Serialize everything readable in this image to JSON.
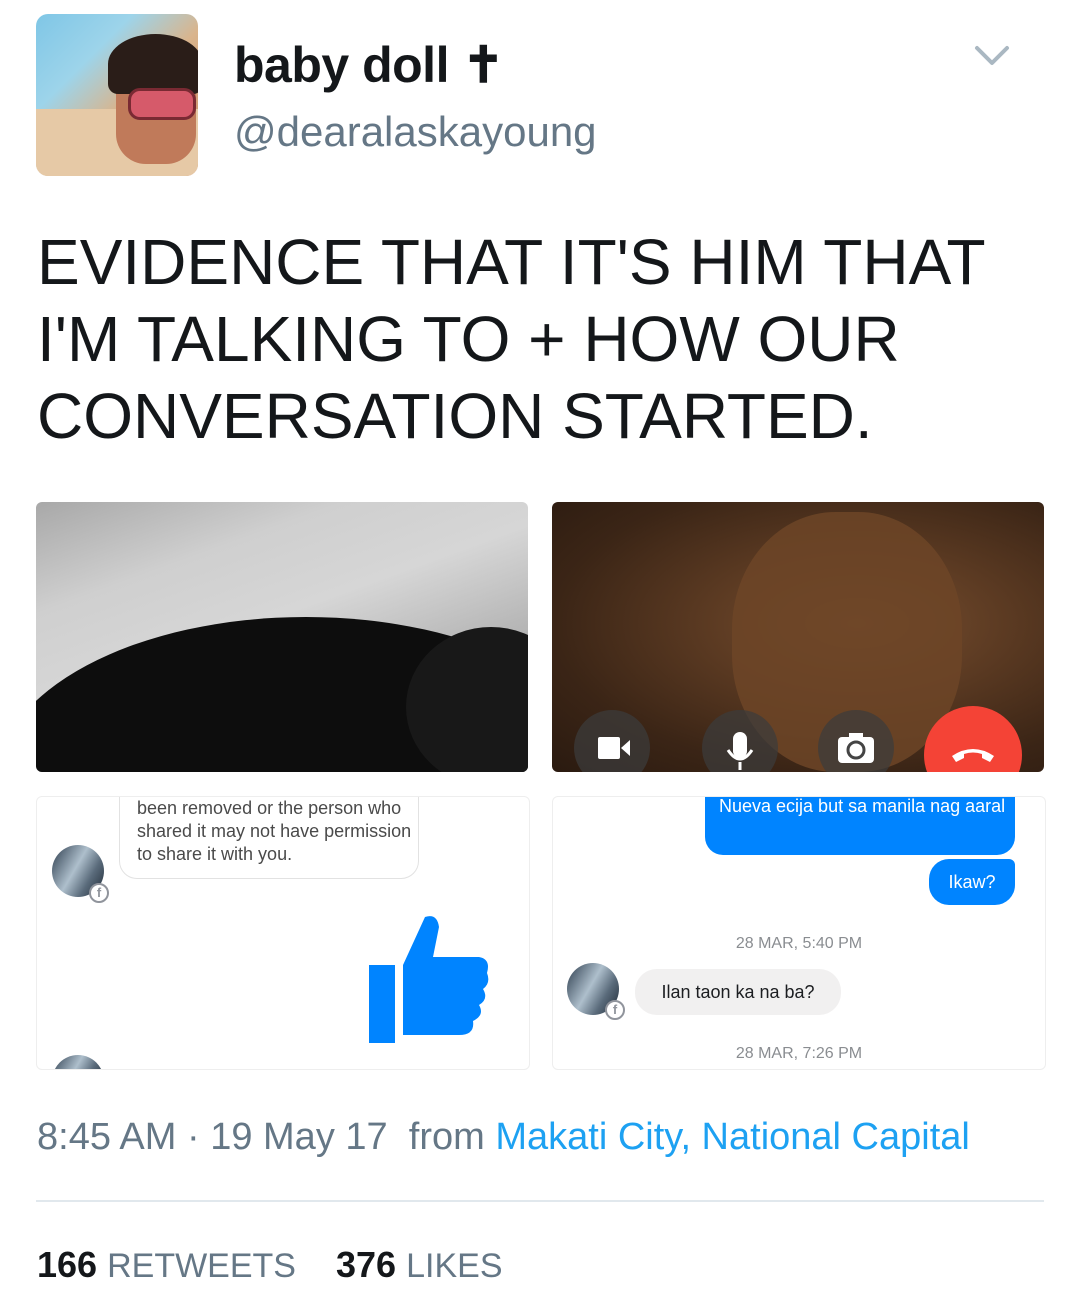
{
  "user": {
    "display_name": "baby doll ✝",
    "handle": "@dearalaskayoung"
  },
  "tweet": {
    "text": "EVIDENCE THAT IT'S HIM THAT I'M TALKING TO + HOW OUR CONVERSATION STARTED."
  },
  "screenshot3": {
    "message": "been removed or the person who shared it may not have permission to share it with you."
  },
  "screenshot4": {
    "sent_1": "Nueva ecija but sa manila nag aaral",
    "sent_2": "Ikaw?",
    "timestamp_1": "28 MAR, 5:40 PM",
    "received": "Ilan taon ka na ba?",
    "timestamp_2": "28 MAR, 7:26 PM"
  },
  "meta": {
    "time": "8:45 AM",
    "separator": " · ",
    "date": "19 May 17",
    "from_label": "from",
    "location": "Makati City, National Capital"
  },
  "stats": {
    "retweets_count": "166",
    "retweets_label": "RETWEETS",
    "likes_count": "376",
    "likes_label": "LIKES"
  },
  "colors": {
    "link": "#1da1f2",
    "messenger_blue": "#0084ff",
    "end_call_red": "#f44336"
  }
}
